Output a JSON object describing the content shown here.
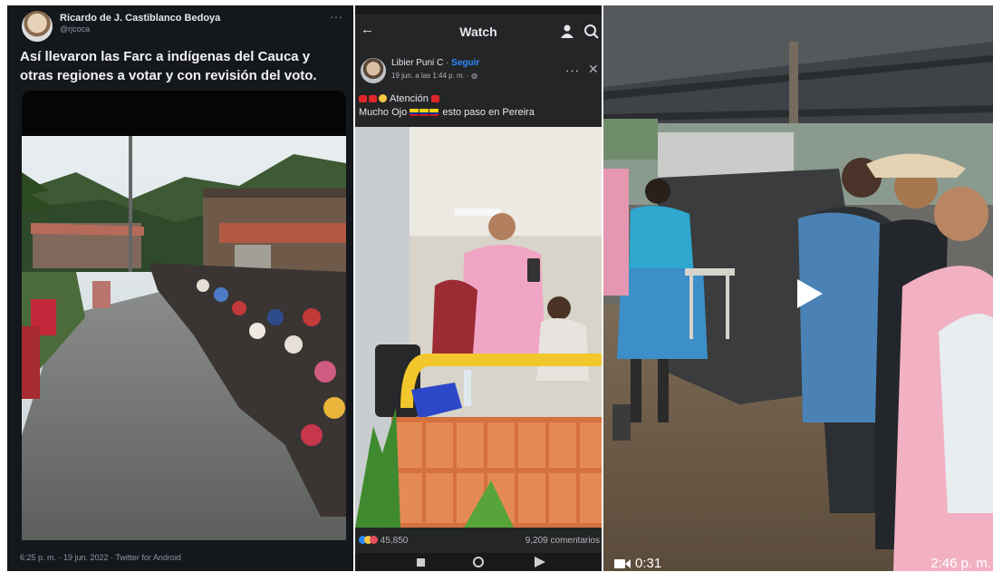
{
  "tweet": {
    "name": "Ricardo de J. Castiblanco Bedoya",
    "handle": "@rjcoca",
    "more": "···",
    "text": "Así llevaron las Farc a indígenas del Cauca y otras regiones a votar y con revisión del voto.",
    "footer": "6:25 p. m. · 19 jun. 2022 · Twitter for Android"
  },
  "facebook": {
    "title": "Watch",
    "author": "Libier Puni C",
    "follow": "Seguir",
    "date": "19 jun. a las 1:44 p. m. ·",
    "more": "···",
    "close": "✕",
    "post_line1": "Atención",
    "post_line2_a": "Mucho Ojo",
    "post_line2_b": "esto paso en Pereira",
    "reactions_count": "45,850",
    "comments_count": "9,209 comentarios"
  },
  "video": {
    "duration": "0:31",
    "clock": "2:46 p. m."
  },
  "colors": {
    "twitter_bg": "#14171c",
    "facebook_bg": "#242526",
    "facebook_link": "#2d88ff"
  }
}
